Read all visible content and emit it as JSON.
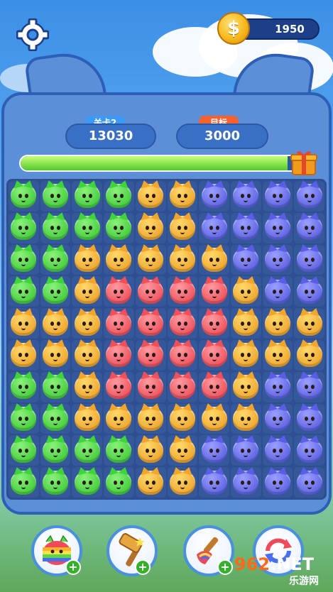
{
  "header": {
    "coins": "1950"
  },
  "level": {
    "tag": "关卡2",
    "score": "13030"
  },
  "target": {
    "tag": "目标",
    "score": "3000"
  },
  "progress": {
    "fraction": 0.95
  },
  "board": {
    "rows": [
      [
        "green",
        "green",
        "green",
        "green",
        "orange",
        "orange",
        "blue",
        "blue",
        "blue",
        "blue"
      ],
      [
        "green",
        "green",
        "green",
        "green",
        "orange",
        "orange",
        "blue",
        "blue",
        "blue",
        "blue"
      ],
      [
        "green",
        "green",
        "orange",
        "orange",
        "orange",
        "orange",
        "orange",
        "blue",
        "blue",
        "blue"
      ],
      [
        "green",
        "green",
        "orange",
        "red",
        "red",
        "red",
        "red",
        "orange",
        "blue",
        "blue"
      ],
      [
        "orange",
        "orange",
        "orange",
        "red",
        "red",
        "red",
        "red",
        "orange",
        "orange",
        "orange"
      ],
      [
        "orange",
        "orange",
        "orange",
        "red",
        "red",
        "red",
        "red",
        "orange",
        "orange",
        "orange"
      ],
      [
        "green",
        "green",
        "orange",
        "red",
        "red",
        "red",
        "red",
        "orange",
        "blue",
        "blue"
      ],
      [
        "green",
        "green",
        "orange",
        "orange",
        "orange",
        "orange",
        "orange",
        "orange",
        "blue",
        "blue"
      ],
      [
        "green",
        "green",
        "green",
        "green",
        "orange",
        "orange",
        "blue",
        "blue",
        "blue",
        "blue"
      ],
      [
        "green",
        "green",
        "green",
        "green",
        "orange",
        "orange",
        "blue",
        "blue",
        "blue",
        "blue"
      ]
    ]
  },
  "tools": [
    {
      "name": "rainbow-cat-booster-icon",
      "plus": "+"
    },
    {
      "name": "hammer-booster-icon",
      "plus": "+"
    },
    {
      "name": "brush-booster-icon",
      "plus": "+"
    },
    {
      "name": "shuffle-booster-icon",
      "plus": "+"
    }
  ],
  "watermark": {
    "brand": "962",
    "suffix": ".NET",
    "sub": "乐游网"
  },
  "colors": {
    "frame": "#5d8fd8",
    "frame_border": "#2c5fb5",
    "level_tag": "#3a9af5",
    "target_tag": "#f5612f"
  }
}
